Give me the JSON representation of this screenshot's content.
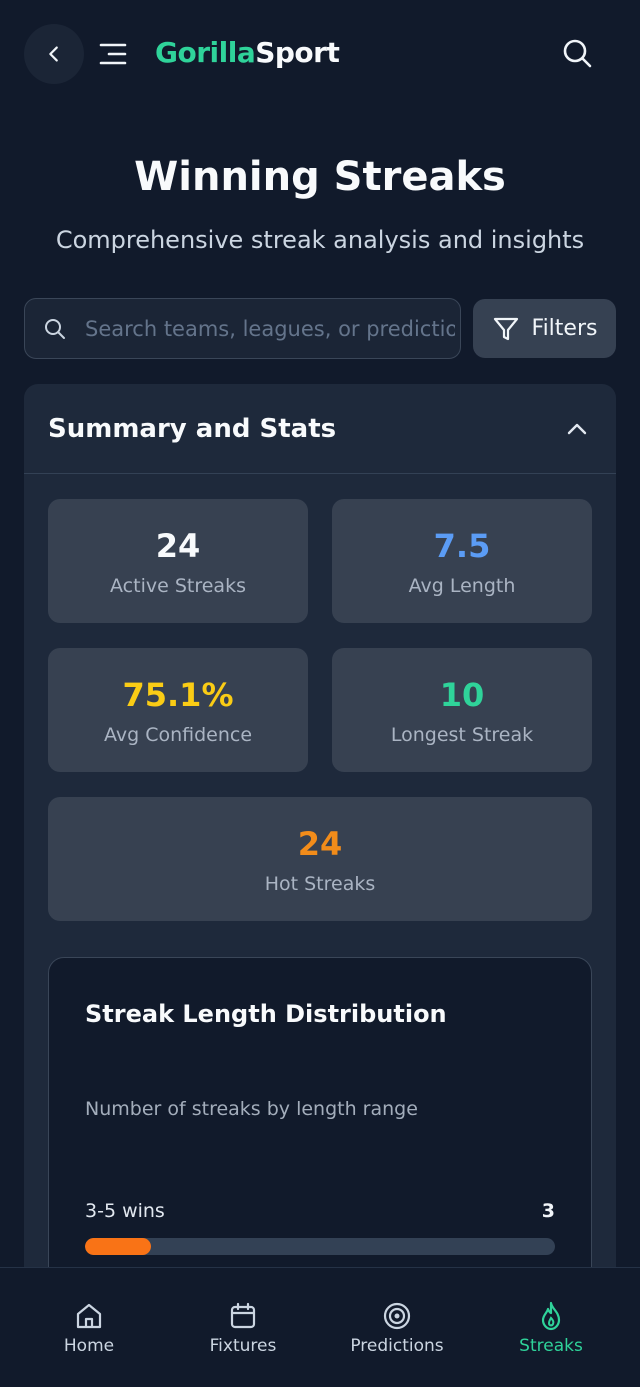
{
  "header": {
    "logo_part1": "Gorilla",
    "logo_part2": "Sport",
    "icons": [
      "back-arrow-icon",
      "menu-icon",
      "search-icon"
    ]
  },
  "page": {
    "title": "Winning Streaks",
    "subtitle": "Comprehensive streak analysis and insights"
  },
  "search": {
    "placeholder": "Search teams, leagues, or predictions...",
    "value": ""
  },
  "filters": {
    "label": "Filters",
    "icon": "filter-icon"
  },
  "summary": {
    "title": "Summary and Stats",
    "expanded": true,
    "stats": [
      {
        "value": "24",
        "label": "Active Streaks",
        "color": "#f8fafc"
      },
      {
        "value": "7.5",
        "label": "Avg Length",
        "color": "#5b9cf5"
      },
      {
        "value": "75.1%",
        "label": "Avg Confidence",
        "color": "#facc15"
      },
      {
        "value": "10",
        "label": "Longest Streak",
        "color": "#2fd39a"
      },
      {
        "value": "24",
        "label": "Hot Streaks",
        "color": "#f28c1a"
      }
    ]
  },
  "distribution": {
    "title": "Streak Length Distribution",
    "subtitle": "Number of streaks by length range",
    "rows": [
      {
        "label": "3-5 wins",
        "count": "3",
        "fraction": 0.14,
        "color": "#f97316"
      }
    ]
  },
  "nav": {
    "items": [
      {
        "label": "Home",
        "icon": "home-icon",
        "active": false
      },
      {
        "label": "Fixtures",
        "icon": "calendar-icon",
        "active": false
      },
      {
        "label": "Predictions",
        "icon": "target-icon",
        "active": false
      },
      {
        "label": "Streaks",
        "icon": "flame-icon",
        "active": true
      }
    ],
    "active_color": "#2fd39a"
  }
}
